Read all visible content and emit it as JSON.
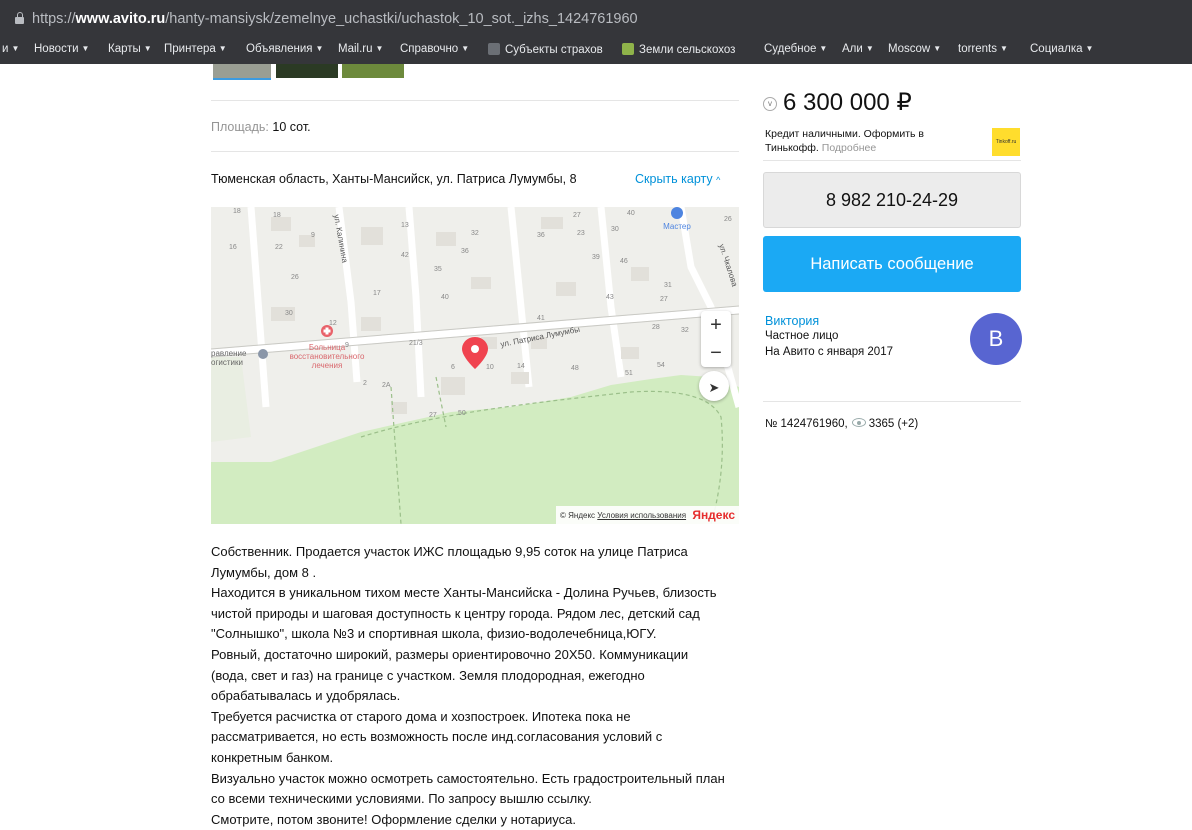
{
  "browser": {
    "url_prefix": "https://",
    "url_host": "www.avito.ru",
    "url_path": "/hanty-mansiysk/zemelnye_uchastki/uchastok_10_sot._izhs_1424761960",
    "bookmarks": [
      "и",
      "Новости",
      "Карты",
      "Принтера",
      "Объявления",
      "Mail.ru",
      "Справочно",
      "Субъекты страхов",
      "Земли сельскохоз",
      "Судебное",
      "Али",
      "Moscow",
      "torrents",
      "Социалка"
    ]
  },
  "listing": {
    "area_label": "Площадь:",
    "area_value": "10 сот.",
    "address": "Тюменская область, Ханты-Мансийск, ул. Патриса Лумумбы, 8",
    "hide_map": "Скрыть карту"
  },
  "map": {
    "street_labels": [
      "ул. Калинина",
      "ул. Патриса Лумумбы",
      "ул. Чкалова"
    ],
    "poi_hospital": [
      "Больница",
      "восстановительного",
      "лечения"
    ],
    "poi_left": [
      "равление",
      "огистики"
    ],
    "poi_master": "Мастер",
    "house_numbers": [
      "18",
      "16",
      "22",
      "9",
      "18",
      "13",
      "32",
      "27",
      "40",
      "26",
      "36",
      "23",
      "42",
      "35",
      "36",
      "39",
      "46",
      "26",
      "17",
      "40",
      "43",
      "31",
      "27",
      "30",
      "12",
      "9",
      "41",
      "28",
      "32",
      "21/3",
      "10",
      "6",
      "14",
      "48",
      "51",
      "54",
      "2А",
      "2",
      "27",
      "50",
      "30"
    ],
    "zoom_in": "+",
    "zoom_out": "−",
    "copyright_prefix": "© Яндекс",
    "terms": "Условия использования",
    "yandex": "Яндекс"
  },
  "description": [
    "Собственник. Продается участок ИЖС площадью 9,95 соток на улице Патриса",
    "Лумумбы, дом 8 .",
    "Находится в уникальном тихом месте Ханты-Мансийска - Долина Ручьев, близость",
    "чистой природы и шаговая доступность к центру города. Рядом лес, детский сад",
    "\"Солнышко\", школа №3 и спортивная школа, физио-водолечебница,ЮГУ.",
    "Ровный, достаточно широкий, размеры ориентировочно 20Х50. Коммуникации",
    "(вода, свет и газ) на границе с участком. Земля плодородная, ежегодно",
    "обрабатывалась и удобрялась.",
    "Требуется расчистка от старого дома и хозпостроек. Ипотека пока не",
    "рассматривается, но есть возможность после инд.согласования условий с",
    "конкретным банком.",
    "Визуально участок можно осмотреть самостоятельно. Есть градостроительный план",
    "со всеми техническими условиями. По запросу вышлю ссылку.",
    "Смотрите, потом звоните! Оформление сделки у нотариуса."
  ],
  "sidebar": {
    "price": "6 300 000 ₽",
    "credit_line1": "Кредит наличными. Оформить в",
    "credit_line2": "Тинькофф.",
    "credit_more": "Подробнее",
    "tinkoff_logo": "Tinkoff.ru",
    "phone": "8 982 210-24-29",
    "message_button": "Написать сообщение",
    "seller_name": "Виктория",
    "seller_type": "Частное лицо",
    "seller_since": "На Авито с января 2017",
    "avatar_letter": "В",
    "listing_number": "№ 1424761960,",
    "views": "3365 (+2)"
  }
}
